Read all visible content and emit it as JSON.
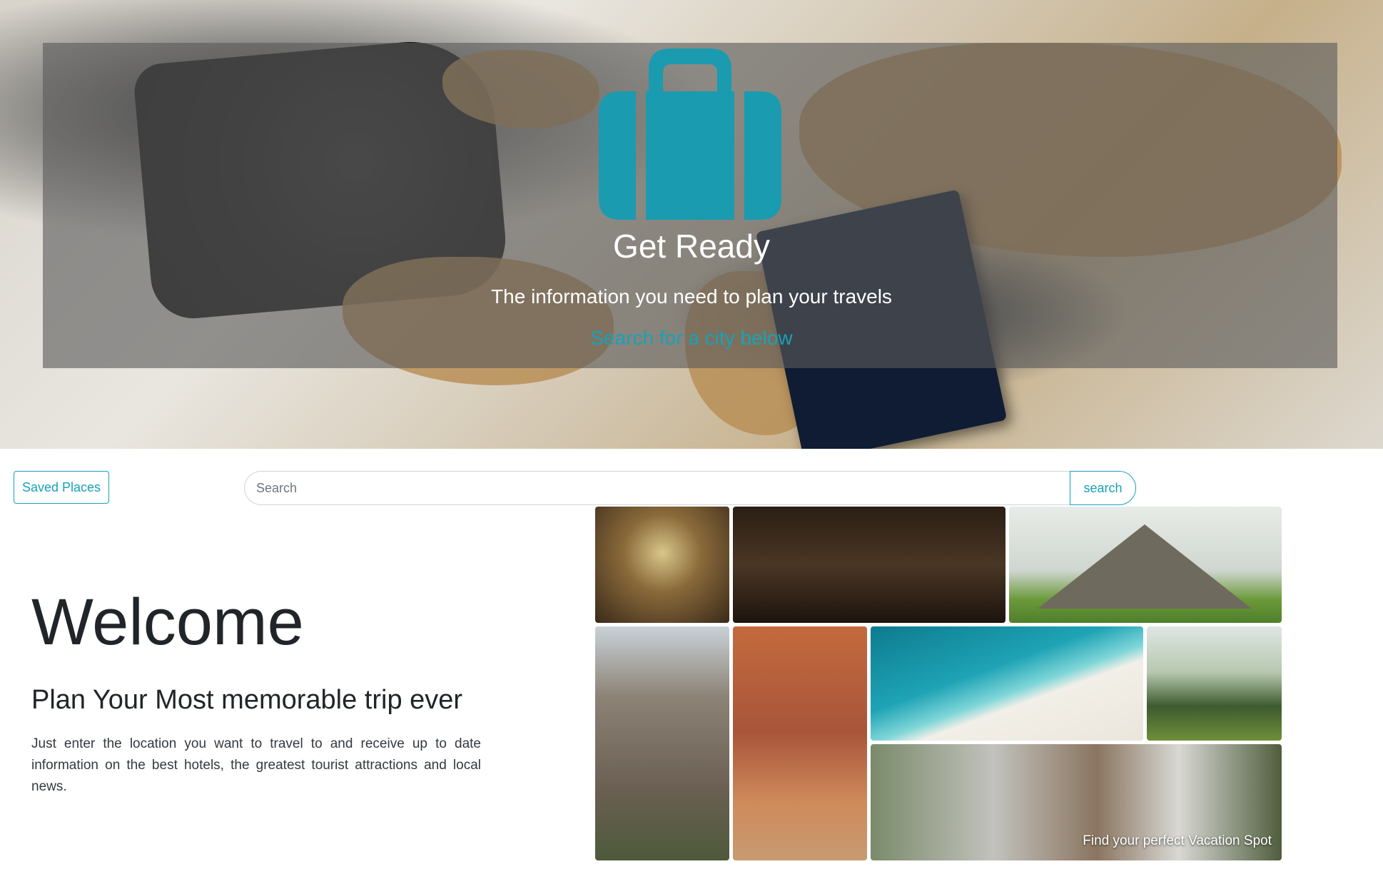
{
  "hero": {
    "title": "Get Ready",
    "subtitle": "The information you need to plan your travels",
    "cta": "Search for a city below",
    "icon": "suitcase-icon",
    "accent_color": "#1a9bb0",
    "background_image": "travel-desk-photo"
  },
  "toolbar": {
    "saved_places_label": "Saved Places",
    "search_placeholder": "Search",
    "search_value": "",
    "search_button_label": "search"
  },
  "intro": {
    "heading": "Welcome",
    "tagline": "Plan Your Most memorable trip ever",
    "description": "Just enter the location you want to travel to and receive up to date information on the best hotels, the greatest tourist attractions and local news."
  },
  "gallery": {
    "photos": [
      {
        "name": "ornate-dome-photo"
      },
      {
        "name": "library-interior-photo"
      },
      {
        "name": "chichen-itza-photo"
      },
      {
        "name": "notre-dame-photo"
      },
      {
        "name": "petra-camel-photo"
      },
      {
        "name": "beach-palm-photo"
      },
      {
        "name": "mountain-landscape-photo"
      },
      {
        "name": "city-buildings-photo"
      }
    ],
    "caption": "Find your perfect Vacation Spot"
  },
  "colors": {
    "accent": "#17a2b8",
    "text": "#212529"
  }
}
